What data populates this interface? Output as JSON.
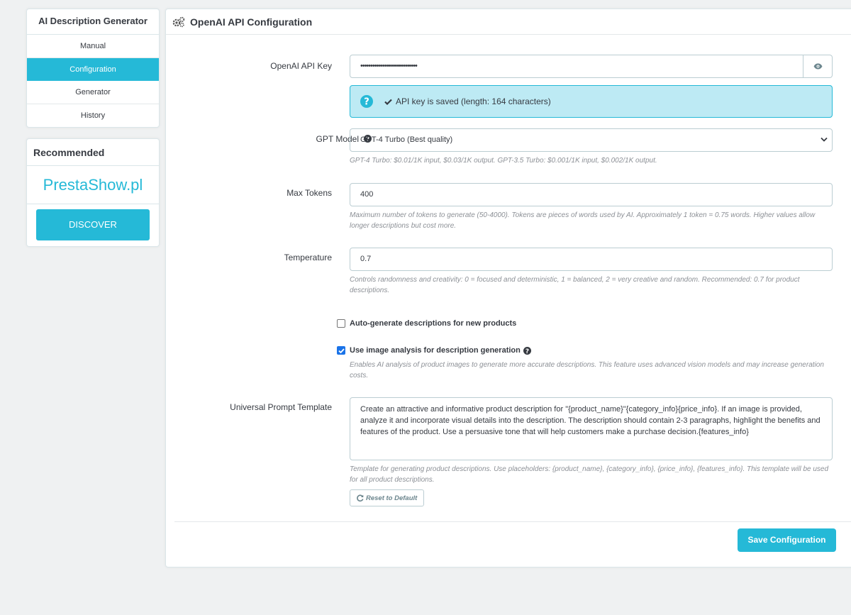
{
  "sidebar": {
    "title": "AI Description Generator",
    "items": [
      {
        "label": "Manual"
      },
      {
        "label": "Configuration"
      },
      {
        "label": "Generator"
      },
      {
        "label": "History"
      }
    ],
    "recommended": {
      "title": "Recommended",
      "brand": "PrestaShow.pl",
      "button": "DISCOVER"
    }
  },
  "panel": {
    "title": "OpenAI API Configuration",
    "api_key": {
      "label": "OpenAI API Key",
      "value": "••••••••••••••••••••••••••••",
      "status": "API key is saved (length: 164 characters)"
    },
    "model": {
      "label": "GPT Model",
      "selected": "GPT-4 Turbo (Best quality)",
      "help": "GPT-4 Turbo: $0.01/1K input, $0.03/1K output. GPT-3.5 Turbo: $0.001/1K input, $0.002/1K output."
    },
    "max_tokens": {
      "label": "Max Tokens",
      "value": "400",
      "help": "Maximum number of tokens to generate (50-4000). Tokens are pieces of words used by AI. Approximately 1 token = 0.75 words. Higher values allow longer descriptions but cost more."
    },
    "temperature": {
      "label": "Temperature",
      "value": "0.7",
      "help": "Controls randomness and creativity: 0 = focused and deterministic, 1 = balanced, 2 = very creative and random. Recommended: 0.7 for product descriptions."
    },
    "auto_generate": {
      "label": "Auto-generate descriptions for new products",
      "checked": false
    },
    "image_analysis": {
      "label": "Use image analysis for description generation",
      "checked": true,
      "help": "Enables AI analysis of product images to generate more accurate descriptions. This feature uses advanced vision models and may increase generation costs."
    },
    "prompt_template": {
      "label": "Universal Prompt Template",
      "value": "Create an attractive and informative product description for \"{product_name}\"{category_info}{price_info}. If an image is provided, analyze it and incorporate visual details into the description. The description should contain 2-3 paragraphs, highlight the benefits and features of the product. Use a persuasive tone that will help customers make a purchase decision.{features_info}",
      "help": "Template for generating product descriptions. Use placeholders: {product_name}, {category_info}, {price_info}, {features_info}. This template will be used for all product descriptions.",
      "reset_label": "Reset to Default"
    },
    "save_label": "Save Configuration"
  },
  "colors": {
    "accent": "#25b9d7",
    "alert_bg": "#bdeaf4"
  }
}
